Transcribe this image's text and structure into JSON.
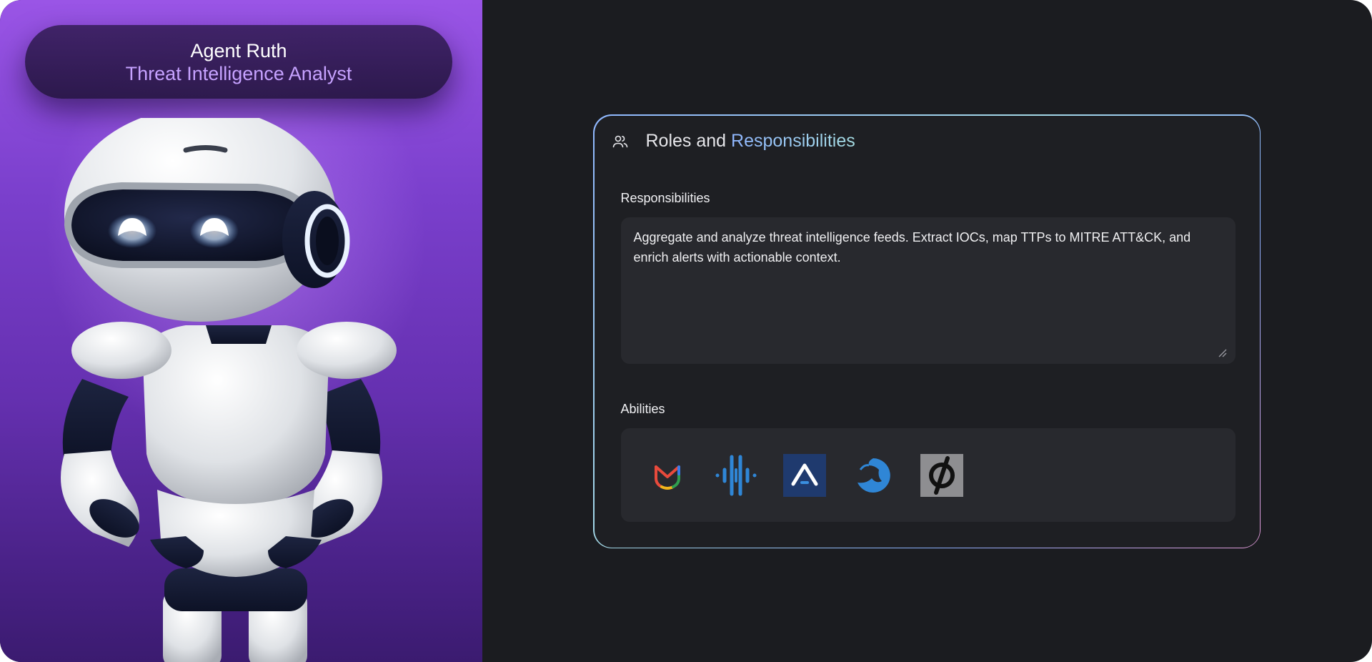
{
  "agent": {
    "name": "Agent Ruth",
    "role": "Threat Intelligence Analyst"
  },
  "card": {
    "title_part1": "Roles and ",
    "title_part2": "Responsibilities",
    "icon": "users-icon"
  },
  "responsibilities": {
    "label": "Responsibilities",
    "value": "Aggregate and analyze threat intelligence feeds. Extract IOCs, map TTPs to MITRE ATT&CK, and enrich alerts with actionable context."
  },
  "abilities": {
    "label": "Abilities",
    "items": [
      {
        "icon": "gmail-shield-logo-icon"
      },
      {
        "icon": "soundwave-logo-icon"
      },
      {
        "icon": "arrow-a-logo-icon"
      },
      {
        "icon": "crescent-beast-logo-icon"
      },
      {
        "icon": "null-slash-logo-icon"
      }
    ]
  },
  "colors": {
    "panel_purple": "#7a3fcc",
    "background": "#1b1c20",
    "card_bg": "#1e1f23",
    "field_bg": "#28292e",
    "accent_text": "#c6a2ff",
    "title_accent": "#8fb6ff"
  }
}
